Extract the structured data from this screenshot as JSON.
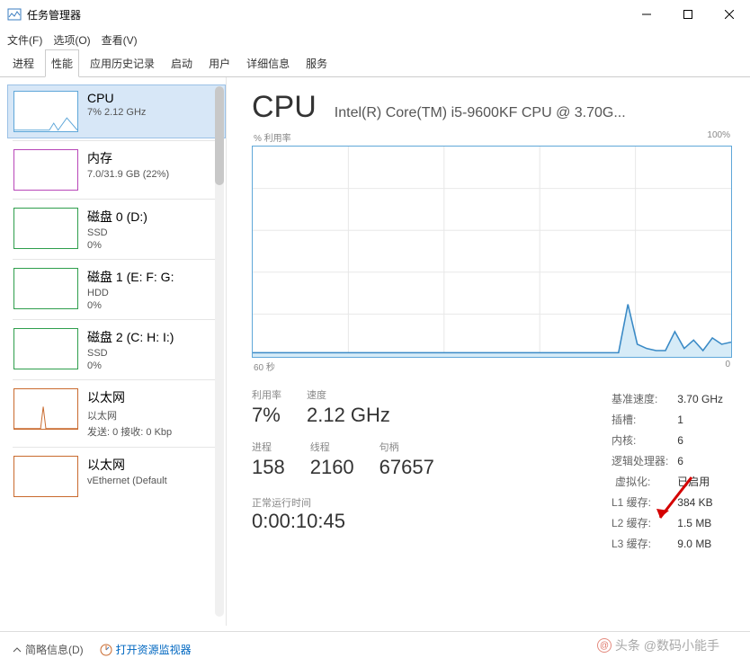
{
  "window": {
    "title": "任务管理器"
  },
  "menu": [
    "文件(F)",
    "选项(O)",
    "查看(V)"
  ],
  "tabs": [
    "进程",
    "性能",
    "应用历史记录",
    "启动",
    "用户",
    "详细信息",
    "服务"
  ],
  "active_tab": 1,
  "sidebar": [
    {
      "title": "CPU",
      "sub": "7%  2.12 GHz",
      "color": "#5fa7d9",
      "spark": "cpu"
    },
    {
      "title": "内存",
      "sub": "7.0/31.9 GB (22%)",
      "color": "#b846b8"
    },
    {
      "title": "磁盘 0 (D:)",
      "sub": "SSD",
      "pct": "0%",
      "color": "#2e9e4c"
    },
    {
      "title": "磁盘 1 (E: F: G:",
      "sub": "HDD",
      "pct": "0%",
      "color": "#2e9e4c"
    },
    {
      "title": "磁盘 2 (C: H: I:)",
      "sub": "SSD",
      "pct": "0%",
      "color": "#2e9e4c"
    },
    {
      "title": "以太网",
      "sub": "以太网",
      "pct": "发送: 0 接收: 0 Kbp",
      "color": "#c96a2e",
      "spark": "eth"
    },
    {
      "title": "以太网",
      "sub": "vEthernet (Default",
      "color": "#c96a2e"
    }
  ],
  "main": {
    "heading": "CPU",
    "model": "Intel(R) Core(TM) i5-9600KF CPU @ 3.70G...",
    "graph_top_left": "% 利用率",
    "graph_top_right": "100%",
    "graph_bot_left": "60 秒",
    "graph_bot_right": "0",
    "stats_left": [
      {
        "lbl": "利用率",
        "val": "7%"
      },
      {
        "lbl": "速度",
        "val": "2.12 GHz"
      }
    ],
    "stats_left2": [
      {
        "lbl": "进程",
        "val": "158"
      },
      {
        "lbl": "线程",
        "val": "2160"
      },
      {
        "lbl": "句柄",
        "val": "67657"
      }
    ],
    "uptime_lbl": "正常运行时间",
    "uptime_val": "0:00:10:45",
    "stats_right": [
      [
        "基准速度:",
        "3.70 GHz"
      ],
      [
        "插槽:",
        "1"
      ],
      [
        "内核:",
        "6"
      ],
      [
        "逻辑处理器:",
        "6"
      ],
      [
        "虚拟化:",
        "已启用"
      ],
      [
        "L1 缓存:",
        "384 KB"
      ],
      [
        "L2 缓存:",
        "1.5 MB"
      ],
      [
        "L3 缓存:",
        "9.0 MB"
      ]
    ],
    "highlight_row": 4
  },
  "footer": {
    "brief": "简略信息(D)",
    "resmon": "打开资源监视器"
  },
  "watermark": "头条 @数码小能手",
  "chart_data": {
    "type": "line",
    "title": "% 利用率",
    "xlabel": "秒",
    "ylabel": "%",
    "ylim": [
      0,
      100
    ],
    "x_range_sec": [
      60,
      0
    ],
    "series": [
      {
        "name": "CPU 利用率",
        "values": [
          2,
          2,
          2,
          2,
          2,
          2,
          2,
          2,
          2,
          2,
          2,
          2,
          2,
          2,
          2,
          2,
          2,
          2,
          2,
          2,
          2,
          2,
          2,
          2,
          2,
          2,
          2,
          2,
          2,
          2,
          2,
          2,
          2,
          2,
          2,
          2,
          2,
          2,
          2,
          2,
          25,
          6,
          4,
          3,
          3,
          12,
          4,
          8,
          3,
          9,
          6,
          7
        ]
      }
    ]
  }
}
